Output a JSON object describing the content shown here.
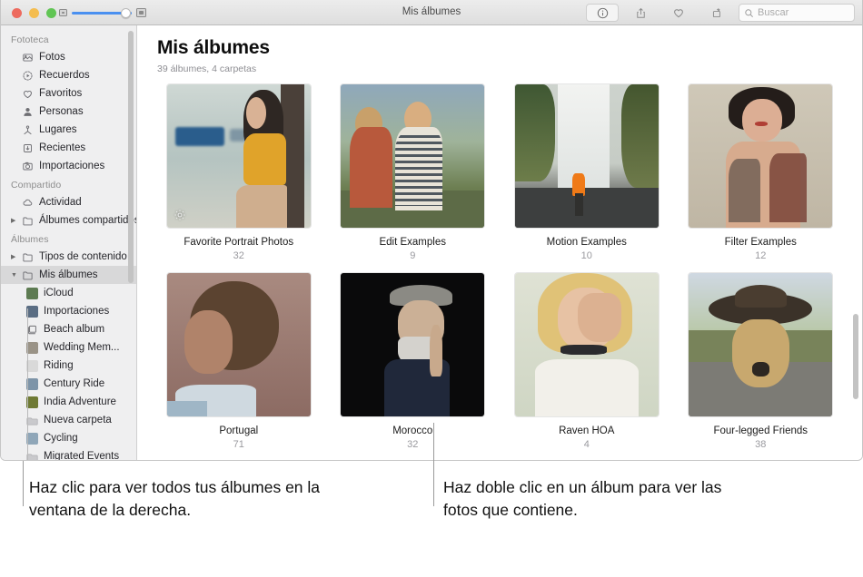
{
  "window": {
    "title": "Mis álbumes",
    "traffic_lights": [
      "close",
      "minimize",
      "maximize"
    ],
    "zoom_slider": {
      "name": "thumbnail-size-slider",
      "value": 88,
      "min_icon": "small-thumbnail-icon",
      "max_icon": "large-thumbnail-icon",
      "accent": "#4a90f0"
    }
  },
  "toolbar": {
    "buttons": [
      {
        "name": "info-button",
        "icon": "info-icon",
        "label": "Info",
        "active": true
      },
      {
        "name": "share-button",
        "icon": "share-icon",
        "label": "Compartir",
        "active": false
      },
      {
        "name": "favorite-button",
        "icon": "heart-icon",
        "label": "Favorito",
        "active": false
      },
      {
        "name": "rotate-button",
        "icon": "rotate-icon",
        "label": "Girar",
        "active": false
      }
    ],
    "search": {
      "placeholder": "Buscar",
      "value": "",
      "icon": "search-icon"
    }
  },
  "sidebar": {
    "sections": [
      {
        "header": "Fototeca",
        "items": [
          {
            "label": "Fotos",
            "icon": "photos-icon"
          },
          {
            "label": "Recuerdos",
            "icon": "memories-icon"
          },
          {
            "label": "Favoritos",
            "icon": "heart-icon"
          },
          {
            "label": "Personas",
            "icon": "person-icon"
          },
          {
            "label": "Lugares",
            "icon": "places-pin-icon"
          },
          {
            "label": "Recientes",
            "icon": "recents-download-icon"
          },
          {
            "label": "Importaciones",
            "icon": "imports-camera-icon"
          }
        ]
      },
      {
        "header": "Compartido",
        "items": [
          {
            "label": "Actividad",
            "icon": "cloud-icon"
          },
          {
            "label": "Álbumes compartidos",
            "icon": "folder-icon",
            "disclosure": "collapsed"
          }
        ]
      },
      {
        "header": "Álbumes",
        "items": [
          {
            "label": "Tipos de contenido",
            "icon": "folder-icon",
            "disclosure": "collapsed"
          },
          {
            "label": "Mis álbumes",
            "icon": "folder-icon",
            "disclosure": "expanded",
            "selected": true
          },
          {
            "label": "iCloud",
            "icon": "album-thumbnail",
            "child": true,
            "thumb": "#5d7b52"
          },
          {
            "label": "Importaciones",
            "icon": "album-thumbnail",
            "child": true,
            "thumb": "#5a6d83"
          },
          {
            "label": "Beach album",
            "icon": "album-stack-icon",
            "child": true,
            "thumb": "#d5d5d7"
          },
          {
            "label": "Wedding Mem...",
            "icon": "album-thumbnail",
            "child": true,
            "thumb": "#9a9387"
          },
          {
            "label": "Riding",
            "icon": "album-thumbnail",
            "child": true,
            "thumb": "#d9d9d9"
          },
          {
            "label": "Century Ride",
            "icon": "album-thumbnail",
            "child": true,
            "thumb": "#7d94a8"
          },
          {
            "label": "India Adventure",
            "icon": "album-thumbnail",
            "child": true,
            "thumb": "#6f7a34"
          },
          {
            "label": "Nueva carpeta",
            "icon": "folder-icon",
            "child": true,
            "thumb": ""
          },
          {
            "label": "Cycling",
            "icon": "album-thumbnail",
            "child": true,
            "thumb": "#8fa6b8"
          },
          {
            "label": "Migrated Events",
            "icon": "folder-icon",
            "child": true,
            "thumb": ""
          }
        ]
      }
    ],
    "scrollbar": {
      "name": "sidebar-scrollbar"
    }
  },
  "main": {
    "title": "Mis álbumes",
    "subtitle": "39 álbumes, 4 carpetas",
    "albums": [
      {
        "name": "Favorite Portrait Photos",
        "count": "32",
        "smart": true,
        "scene": "woman-boat-yellow-jacket"
      },
      {
        "name": "Edit Examples",
        "count": "9",
        "smart": false,
        "scene": "two-women-laughing-outdoors"
      },
      {
        "name": "Motion Examples",
        "count": "10",
        "smart": false,
        "scene": "waterfall-orange-hoodie"
      },
      {
        "name": "Filter Examples",
        "count": "12",
        "smart": false,
        "scene": "tattooed-woman-portrait"
      },
      {
        "name": "Portugal",
        "count": "71",
        "smart": false,
        "scene": "curly-hair-woman-portrait"
      },
      {
        "name": "Morocco",
        "count": "32",
        "smart": false,
        "scene": "older-man-flat-cap-dark"
      },
      {
        "name": "Raven HOA",
        "count": "4",
        "smart": false,
        "scene": "woman-hand-over-eye"
      },
      {
        "name": "Four-legged Friends",
        "count": "38",
        "smart": false,
        "scene": "dog-with-hat-road"
      }
    ],
    "scrollbar": {
      "name": "main-scrollbar"
    }
  },
  "callouts": [
    {
      "name": "callout-sidebar",
      "text": "Haz clic para ver todos tus álbumes en la ventana de la derecha."
    },
    {
      "name": "callout-album",
      "text": "Haz doble clic en un álbum para ver las fotos que contiene."
    }
  ]
}
